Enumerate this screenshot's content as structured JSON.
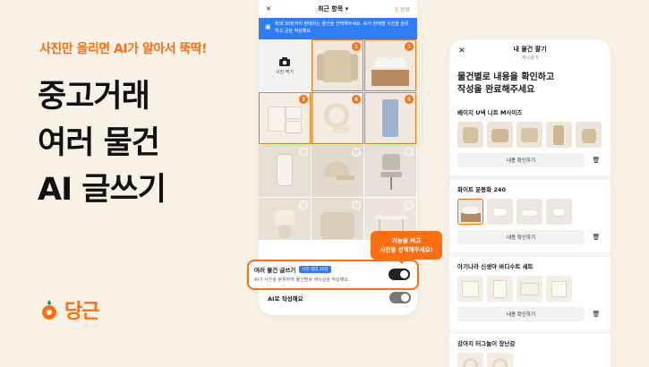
{
  "promo": {
    "tagline": "사진만 올리면 AI가 알아서 뚝딱!",
    "headline": [
      "중고거래",
      "여러 물건",
      "AI 글쓰기"
    ],
    "brand": "당근"
  },
  "phone1": {
    "close": "✕",
    "title": "최근 항목",
    "title_caret": "▾",
    "done_count": "5",
    "done_label": "완료",
    "banner_text": "최대 30장까지 판매하는 물건을 선택해주세요. AI가 판매할 사진을 분류하고 글을 작성해요.",
    "camera_label": "사진 찍기",
    "badges": [
      "1",
      "2",
      "3",
      "4",
      "5"
    ],
    "toggle_title": "여러 물건 글쓰기",
    "toggle_chip": "사진 최대 30장",
    "toggle_desc": "AI가 사진을 분류하여 물건별로 게시글을 작성해요.",
    "ai_label": "AI로 작성해요",
    "tooltip": [
      "기능을 켜고",
      "사진을 선택해주세요!"
    ]
  },
  "phone2": {
    "close": "✕",
    "title": "내 물건 팔기",
    "subtitle": "게시글 5",
    "heading": [
      "물건별로 내용을 확인하고",
      "작성을 완료해주세요"
    ],
    "sections": [
      {
        "title": "베이지 U넥 니트 M사이즈",
        "button": "내용 확인하기"
      },
      {
        "title": "화이트 운동화 240",
        "button": "내용 확인하기"
      },
      {
        "title": "아기나라 신생아 바디수트 세트",
        "button": "내용 확인하기"
      },
      {
        "title": "강아지 터그놀이 장난감",
        "button": ""
      }
    ]
  },
  "colors": {
    "accent": "#ff6f0f",
    "blue": "#2e7cf6",
    "background": "#f7f1e6"
  }
}
